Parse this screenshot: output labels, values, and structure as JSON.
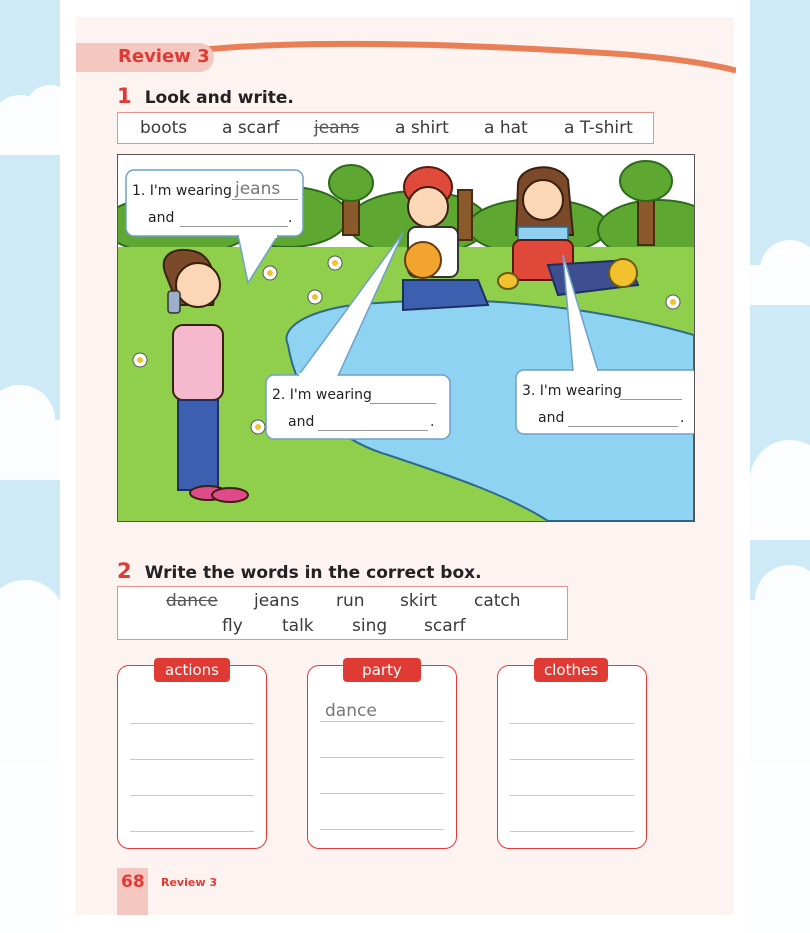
{
  "header": {
    "review_label": "Review 3"
  },
  "section1": {
    "number": "1",
    "title": "Look and write.",
    "words": [
      "boots",
      "a scarf",
      "jeans",
      "a shirt",
      "a hat",
      "a T-shirt"
    ],
    "crossed_word_index": 2
  },
  "bubbles": [
    {
      "line1": "1. I'm wearing",
      "answer": "jeans",
      "line2": "and",
      "period": "."
    },
    {
      "line1": "2. I'm wearing",
      "answer": "",
      "line2": "and",
      "period": "."
    },
    {
      "line1": "3. I'm wearing",
      "answer": "",
      "line2": "and",
      "period": "."
    }
  ],
  "section2": {
    "number": "2",
    "title": "Write the words in the correct box.",
    "words_row1": [
      "dance",
      "jeans",
      "run",
      "skirt",
      "catch"
    ],
    "words_row2": [
      "fly",
      "talk",
      "sing",
      "scarf"
    ],
    "crossed_word": "dance"
  },
  "categories": [
    {
      "label": "actions",
      "answer": ""
    },
    {
      "label": "party",
      "answer": "dance"
    },
    {
      "label": "clothes",
      "answer": ""
    }
  ],
  "footer": {
    "page_number": "68",
    "label": "Review 3"
  },
  "colors": {
    "accent": "#e03a35",
    "tab": "#f4c8c0",
    "box_border": "#e9918b"
  }
}
